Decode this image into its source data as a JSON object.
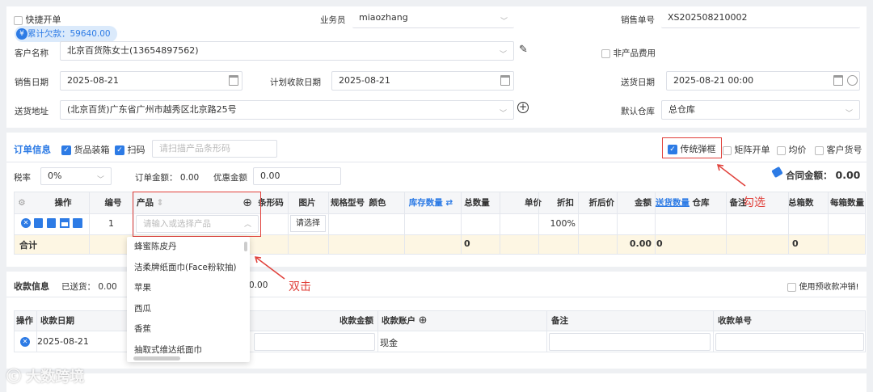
{
  "header": {
    "quick_order_label": "快捷开单",
    "debt_badge": "累计欠款：59640.00",
    "salesman_label": "业务员",
    "salesman_value": "miaozhang",
    "order_no_label": "销售单号",
    "order_no_value": "XS202508210002",
    "customer_label": "客户名称",
    "customer_value": "北京百货陈女士(13654897562)",
    "non_product_fee_label": "非产品费用",
    "sale_date_label": "销售日期",
    "sale_date_value": "2025-08-21",
    "plan_collect_label": "计划收款日期",
    "plan_collect_value": "2025-08-21",
    "delivery_date_label": "送货日期",
    "delivery_date_value": "2025-08-21 00:00",
    "address_label": "送货地址",
    "address_value": "(北京百货)广东省广州市越秀区北京路25号",
    "warehouse_label": "默认仓库",
    "warehouse_value": "总仓库"
  },
  "order": {
    "title": "订单信息",
    "goods_pack_label": "货品装箱",
    "scan_label": "扫码",
    "barcode_placeholder": "请扫描产品条形码",
    "traditional_popup_label": "传统弹框",
    "matrix_label": "矩阵开单",
    "avg_price_label": "均价",
    "customer_sku_label": "客户货号",
    "tax_label": "税率",
    "tax_value": "0%",
    "order_amount_label": "订单金额：",
    "order_amount_value": "0.00",
    "discount_label": "优惠金额",
    "discount_value": "0.00",
    "contract_amount_label": "合同金额：",
    "contract_amount_value": "0.00",
    "columns": {
      "op": "操作",
      "no": "编号",
      "product": "产品",
      "barcode": "条形码",
      "image": "图片",
      "spec": "规格型号",
      "color": "颜色",
      "stock": "库存数量",
      "total_qty": "总数量",
      "price": "单价",
      "discount": "折扣",
      "after_price": "折后价",
      "amount": "金额",
      "delivered": "送货数量",
      "warehouse": "仓库",
      "remark": "备注",
      "total_boxes": "总箱数",
      "per_box": "每箱数量"
    },
    "row": {
      "no": "1",
      "product_placeholder": "请输入或选择产品",
      "choose_image": "请选择",
      "discount": "100%"
    },
    "total_row": {
      "label": "合计",
      "qty": "0",
      "amount": "0.00",
      "delivered": "0",
      "boxes": "0"
    },
    "dropdown_items": [
      "蜂蜜陈皮丹",
      "洁柔牌纸面巾(Face粉软抽)",
      "苹果",
      "西瓜",
      "香蕉",
      "抽取式维达纸面巾"
    ]
  },
  "annotations": {
    "check_hint": "勾选",
    "double_click_hint": "双击"
  },
  "payment": {
    "title": "收款信息",
    "delivered_label": "已送货：",
    "delivered_value": "0.00",
    "partial_value": "0.00",
    "prepay_label": "使用预收款冲销!",
    "columns": {
      "op": "操作",
      "date": "收款日期",
      "amount": "收款金额",
      "account": "收款账户",
      "remark": "备注",
      "receipt_no": "收款单号"
    },
    "row": {
      "date": "2025-08-21",
      "account": "现金"
    }
  },
  "watermark": "大数跨境",
  "colors": {
    "accent": "#2d7be5",
    "annotation_red": "#e0403a",
    "total_row_bg": "#fdf6e3"
  }
}
